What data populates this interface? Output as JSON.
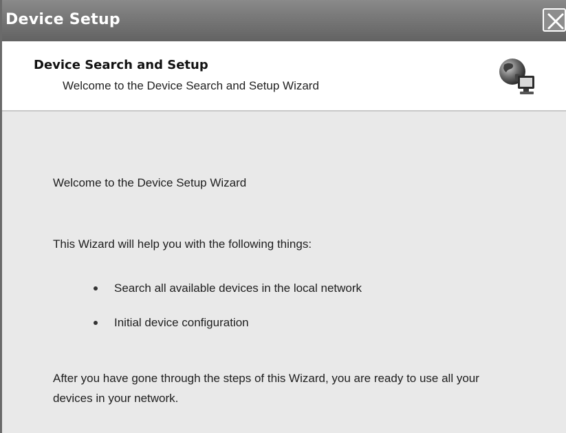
{
  "window": {
    "title": "Device Setup",
    "close_icon": "close-icon"
  },
  "header": {
    "title": "Device Search and Setup",
    "subtitle": "Welcome to the Device Search and Setup Wizard",
    "icon": "network-globe-computer-icon"
  },
  "body": {
    "welcome": "Welcome to the Device Setup Wizard",
    "intro": "This Wizard will help you with the following things:",
    "bullets": [
      "Search all available devices in the local network",
      "Initial device configuration"
    ],
    "closing": "After you have gone through the steps of this Wizard, you are ready to use all your devices in your network."
  }
}
